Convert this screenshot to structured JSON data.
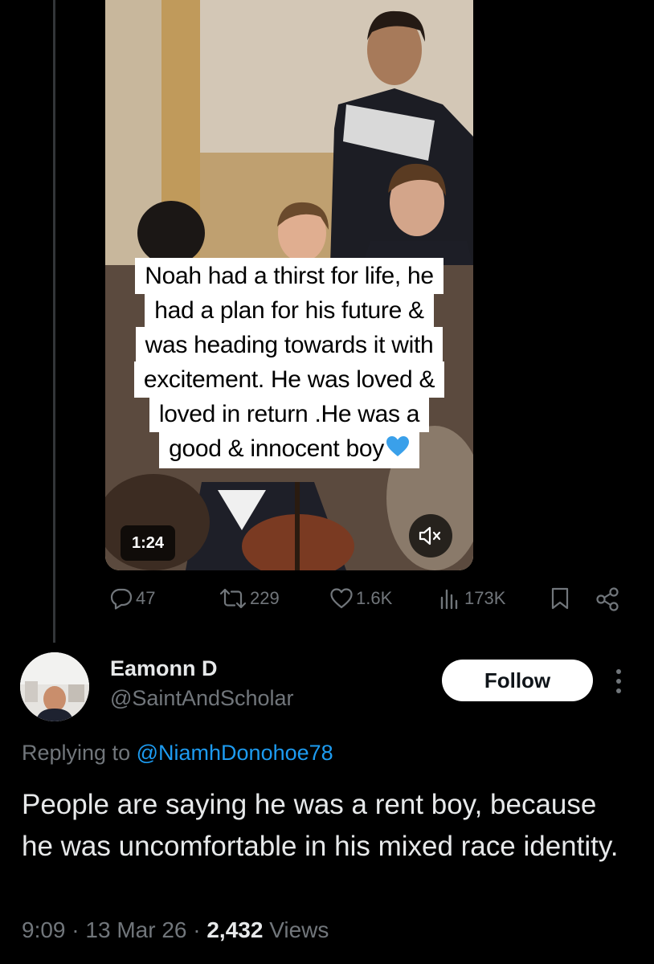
{
  "video": {
    "caption_lines": [
      "Noah had a thirst for life, he",
      "had a plan for his future &",
      "was heading towards it with",
      "excitement. He was loved &",
      "loved in return .He was a",
      "good & innocent boy"
    ],
    "duration": "1:24",
    "caption_emoji": "blue-heart-emoji",
    "mute_icon": "speaker-muted-icon"
  },
  "actions": {
    "replies": "47",
    "reposts": "229",
    "likes": "1.6K",
    "views": "173K",
    "icons": [
      "reply-icon",
      "repost-icon",
      "like-icon",
      "views-icon",
      "bookmark-icon",
      "share-icon"
    ]
  },
  "reply": {
    "display_name": "Eamonn D",
    "handle": "@SaintAndScholar",
    "follow_label": "Follow",
    "replying_prefix": "Replying to",
    "replying_to": "@NiamhDonohoe78",
    "text": "People are saying he was a rent boy, because he was uncomfortable in his mixed race identity.",
    "time": "9:09",
    "date": "13 Mar 26",
    "views_count": "2,432",
    "views_label": "Views"
  },
  "colors": {
    "background": "#000000",
    "text_primary": "#e7e9ea",
    "text_secondary": "#71767b",
    "link": "#1d9bf0",
    "heart": "#3aa0ea"
  }
}
